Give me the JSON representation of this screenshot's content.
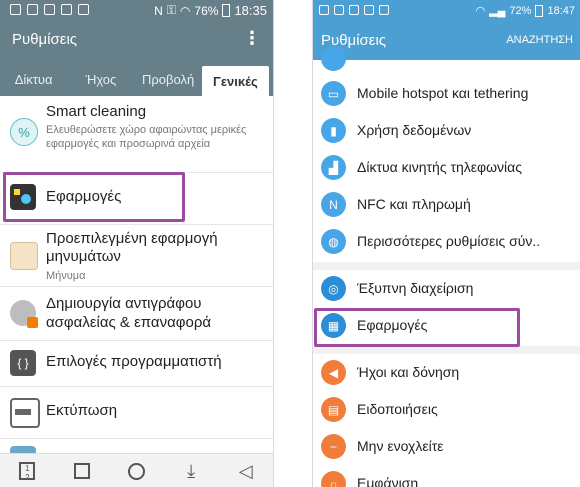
{
  "left": {
    "status": {
      "battery": "76%",
      "time": "18:35"
    },
    "appbar": {
      "title": "Ρυθμίσεις",
      "more_icon": "more-vert-icon"
    },
    "tabs": [
      "Δίκτυα",
      "Ήχος",
      "Προβολή",
      "Γενικές"
    ],
    "rows": [
      {
        "title": "Smart cleaning",
        "subtitle": "Ελευθερώσετε χώρο αφαιρώντας μερικές εφαρμογές και προσωρινά αρχεία",
        "icon": "cleaning-icon"
      },
      {
        "title": "Εφαρμογές",
        "icon": "apps-icon"
      },
      {
        "title": "Προεπιλεγμένη εφαρμογή μηνυμάτων",
        "subtitle": "Μήνυμα",
        "icon": "messages-icon"
      },
      {
        "title": "Δημιουργία αντιγράφου ασφαλείας & επαναφορά",
        "icon": "backup-icon"
      },
      {
        "title": "Επιλογές προγραμματιστή",
        "icon": "developer-icon"
      },
      {
        "title": "Εκτύπωση",
        "icon": "printer-icon"
      }
    ],
    "navbar": [
      "recent-icon",
      "home-square-icon",
      "home-circle-icon",
      "download-icon",
      "back-icon"
    ],
    "colors": {
      "bar": "#667f89",
      "accent": "#9c4ba0"
    }
  },
  "right": {
    "status": {
      "battery": "72%",
      "time": "18:47"
    },
    "appbar": {
      "title": "Ρυθμίσεις",
      "search_label": "ΑΝΑΖΗΤΗΣΗ"
    },
    "rows": [
      {
        "title": "Mobile hotspot και tethering",
        "icon": "hotspot-icon",
        "color": "#48a6e8"
      },
      {
        "title": "Χρήση δεδομένων",
        "icon": "data-usage-icon",
        "color": "#48a6e8"
      },
      {
        "title": "Δίκτυα κινητής τηλεφωνίας",
        "icon": "mobile-network-icon",
        "color": "#48a6e8"
      },
      {
        "title": "NFC και πληρωμή",
        "icon": "nfc-icon",
        "color": "#48a6e8"
      },
      {
        "title": "Περισσότερες ρυθμίσεις σύν..",
        "icon": "more-connections-icon",
        "color": "#48a6e8"
      },
      {
        "title": "Έξυπνη διαχείριση",
        "icon": "smart-manager-icon",
        "color": "#2b8ed6"
      },
      {
        "title": "Εφαρμογές",
        "icon": "apps-grid-icon",
        "color": "#2b8ed6"
      },
      {
        "title": "Ήχοι και δόνηση",
        "icon": "sound-icon",
        "color": "#f07d3a"
      },
      {
        "title": "Ειδοποιήσεις",
        "icon": "notifications-icon",
        "color": "#f07d3a"
      },
      {
        "title": "Μην ενοχλείτε",
        "icon": "do-not-disturb-icon",
        "color": "#f07d3a"
      },
      {
        "title": "Εμφάνιση",
        "icon": "display-icon",
        "color": "#f07d3a"
      }
    ],
    "colors": {
      "bar": "#4b9fd3",
      "accent": "#9c4ba0"
    }
  }
}
